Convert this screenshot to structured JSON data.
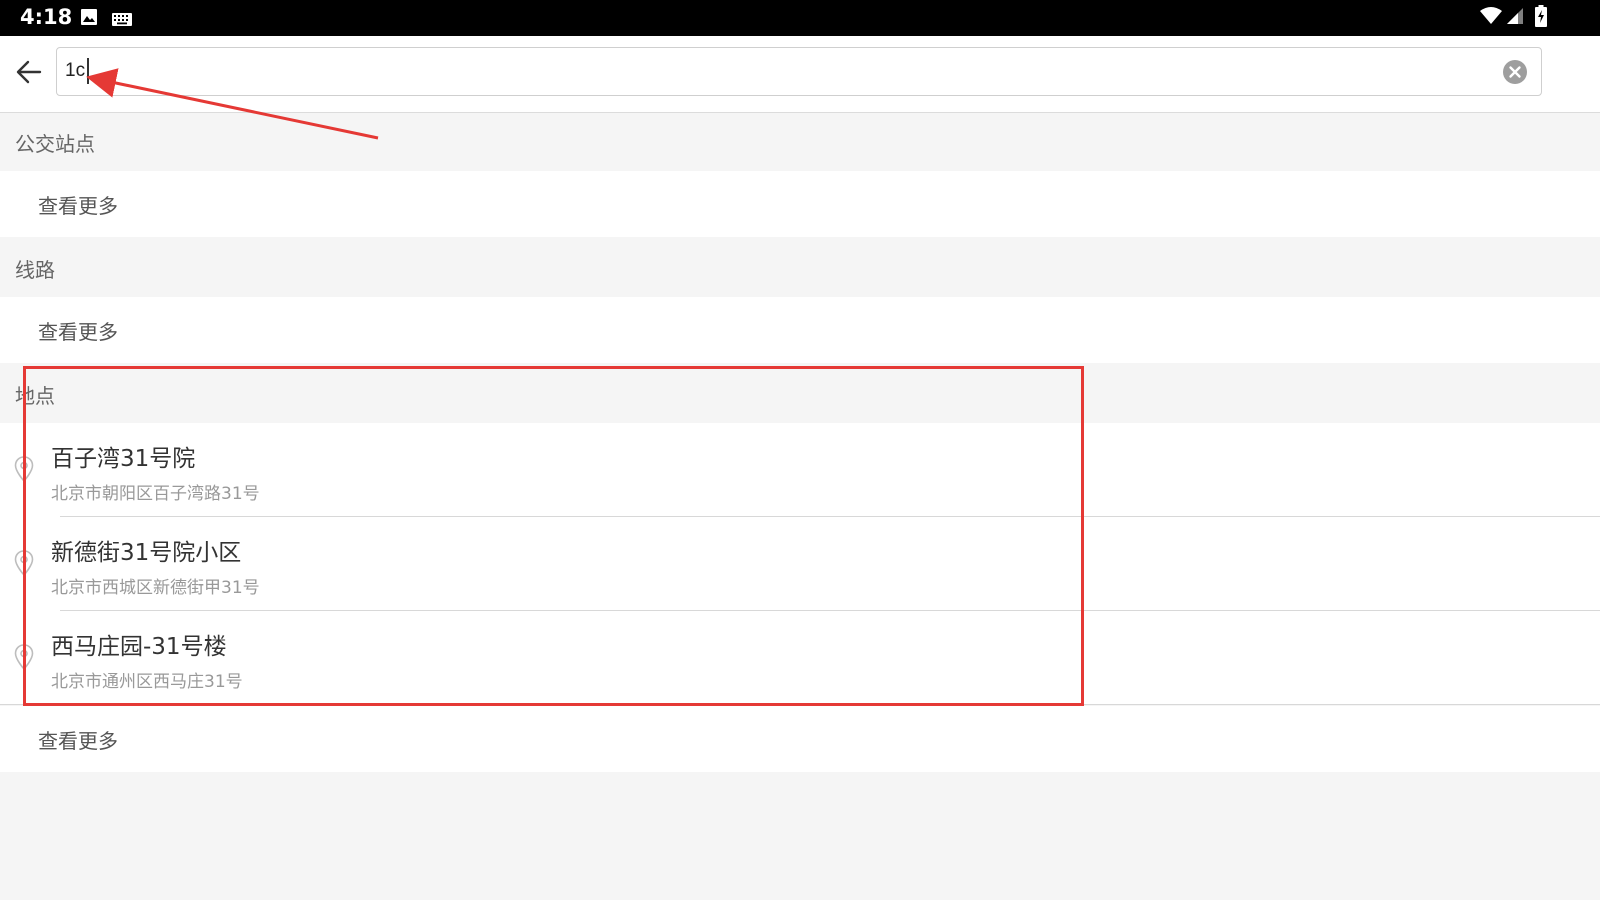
{
  "status_bar": {
    "time": "4:18",
    "left_icons": [
      "image-icon",
      "keyboard-icon"
    ],
    "right_icons": [
      "wifi-icon",
      "signal-icon",
      "battery-icon"
    ]
  },
  "search": {
    "value": "1c",
    "back_icon": "arrow-left-icon",
    "clear_icon": "clear-circle-icon"
  },
  "sections": {
    "bus_stops": {
      "title": "公交站点",
      "more_label": "查看更多"
    },
    "lines": {
      "title": "线路",
      "more_label": "查看更多"
    },
    "places": {
      "title": "地点",
      "items": [
        {
          "name": "百子湾31号院",
          "address": "北京市朝阳区百子湾路31号"
        },
        {
          "name": "新德街31号院小区",
          "address": "北京市西城区新德街甲31号"
        },
        {
          "name": "西马庄园-31号楼",
          "address": "北京市通州区西马庄31号"
        }
      ],
      "more_label": "查看更多"
    }
  },
  "colors": {
    "annotation": "#e53935",
    "section_bg": "#f5f5f5",
    "row_bg": "#ffffff",
    "secondary_text": "#999999"
  }
}
